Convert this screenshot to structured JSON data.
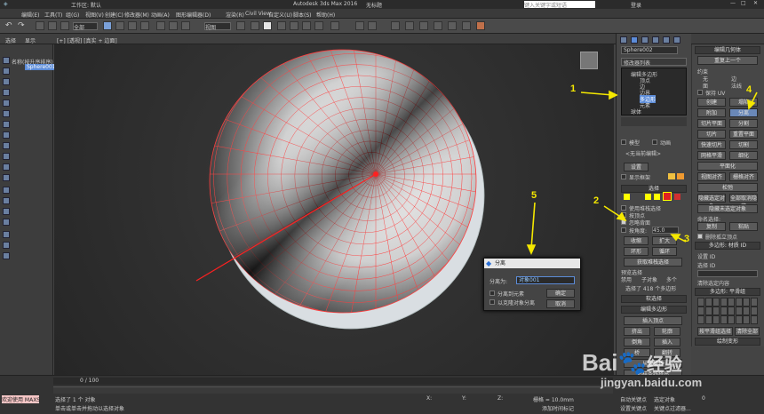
{
  "titlebar": {
    "app_title": "Autodesk 3ds Max 2016",
    "file_title": "无标题",
    "search_placeholder": "键入关键字或短语",
    "login_label": "登录",
    "workspace_label": "工作区: 默认"
  },
  "menus": [
    "编辑(E)",
    "工具(T)",
    "组(G)",
    "视图(V)",
    "创建(C)",
    "修改器(M)",
    "动画(A)",
    "图形编辑器(D)",
    "渲染(R)",
    "Civil View",
    "自定义(U)",
    "脚本(S)",
    "帮助(H)"
  ],
  "toolbar": {
    "view_select": "视图",
    "selection_filter": "全部"
  },
  "ribbon": {
    "tabs": [
      "选择",
      "显示"
    ]
  },
  "scene_explorer": {
    "item_1": "名称(按升序排序)",
    "item_2": "Sphere001"
  },
  "viewport": {
    "label": "[+] [透视] [真实 + 边面]"
  },
  "command_panel": {
    "object_name": "Sphere002",
    "modifier_list": "修改器列表",
    "stack": [
      "编辑多边形",
      "顶点",
      "边",
      "边界",
      "多边形",
      "元素",
      "球体"
    ],
    "model_label": "模型",
    "anim_label": "动画",
    "no_layer": "<无当前编辑>",
    "reset_label": "设置",
    "show_cage": "显示框架",
    "selection_header": "选择",
    "use_stack": "使用堆栈选择",
    "by_vertex": "按顶点",
    "ignore_backface": "忽略背面",
    "by_angle": "按角度:",
    "angle_value": "45.0",
    "shrink": "收缩",
    "grow": "扩大",
    "ring": "环形",
    "loop": "循环",
    "get_stack": "获取堆栈选择",
    "preview": "预览选择",
    "off": "禁用",
    "subobj": "子对象",
    "multi": "多个",
    "selected_count": "选择了 418 个多边形",
    "soft_sel": "软选择",
    "edit_poly_header": "编辑多边形",
    "insert_vertex": "插入顶点",
    "extrude": "挤出",
    "outline": "轮廓",
    "bevel": "倒角",
    "inset": "插入",
    "bridge": "桥",
    "flip": "翻转",
    "hinge": "从边旋转",
    "extrude_spline": "沿样条线挤出",
    "edit_tri": "编辑三角剖分",
    "retri": "重复三角算法",
    "turn": "旋转"
  },
  "edit_geometry": {
    "header": "编辑几何体",
    "repeat": "重复上一个",
    "constraints": "约束",
    "none": "无",
    "edge": "边",
    "face": "面",
    "normal": "法线",
    "preserve_uv": "保持 UV",
    "create": "创建",
    "collapse": "塌陷",
    "attach": "附加",
    "detach": "分离",
    "slice_plane": "切片平面",
    "split": "分割",
    "slice": "切片",
    "reset_plane": "重置平面",
    "quickslice": "快速切片",
    "cut": "切割",
    "msmooth": "网格平滑",
    "tessellate": "细化",
    "make_planar": "平面化",
    "view_align": "视图对齐",
    "grid_align": "栅格对齐",
    "relax": "松弛",
    "hide_sel": "隐藏选定对象",
    "unhide_all": "全部取消隐藏",
    "hide_unsel": "隐藏未选定对象",
    "named_sel": "命名选择:",
    "copy": "复制",
    "paste": "粘贴",
    "delete_iso": "删除孤立顶点",
    "poly_mat": "多边形: 材质 ID",
    "set_id": "设置 ID",
    "select_id": "选择 ID",
    "clear_sel": "清除选定内容",
    "smoothing": "多边形: 平滑组",
    "auto_smooth": "自动平滑",
    "smooth_value": "45.0",
    "select_by_sg": "按平滑组选择",
    "clear_all": "清除全部",
    "vertex_color": "绘制变形"
  },
  "dialog": {
    "title": "分离",
    "detach_as_label": "分离为:",
    "detach_as_value": "对象001",
    "to_element": "分离到元素",
    "as_clone": "以克隆对象分离",
    "ok": "确定",
    "cancel": "取消"
  },
  "status": {
    "welcome": "欢迎使用 MAXS",
    "selected": "选择了 1 个 对象",
    "hint": "单击或单击并拖动以选择对象",
    "timeline": "0 / 100",
    "grid": "栅格 = 10.0mm",
    "add_time_tag": "添加时间标记",
    "auto_key": "自动关键点",
    "selected_obj": "选定对象",
    "set_key": "设置关键点",
    "key_filters": "关键点过滤器...",
    "x_label": "X:",
    "y_label": "Y:",
    "z_label": "Z:",
    "frame": "0"
  },
  "annotations": [
    "1",
    "2",
    "3",
    "4",
    "5"
  ],
  "watermark": {
    "brand": "Bai",
    "brand2": "经验",
    "url": "jingyan.baidu.com"
  },
  "colors": {
    "accent": "#f5e800",
    "wire": "#ff3a3a",
    "sel_blue": "#5c8cd8"
  }
}
